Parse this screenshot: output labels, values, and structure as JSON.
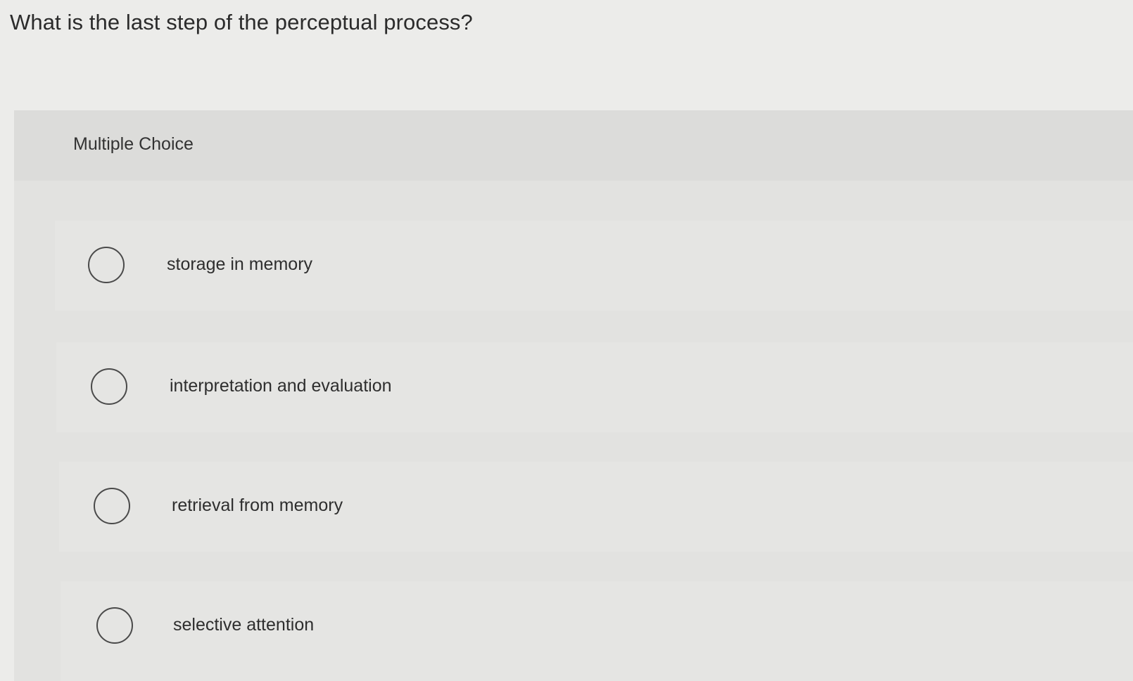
{
  "question": {
    "text": "What is the last step of the perceptual process?"
  },
  "panel": {
    "type_label": "Multiple Choice"
  },
  "options": [
    {
      "label": "storage in memory",
      "selected": false
    },
    {
      "label": "interpretation and evaluation",
      "selected": false
    },
    {
      "label": "retrieval from memory",
      "selected": false
    },
    {
      "label": "selective attention",
      "selected": false
    }
  ]
}
